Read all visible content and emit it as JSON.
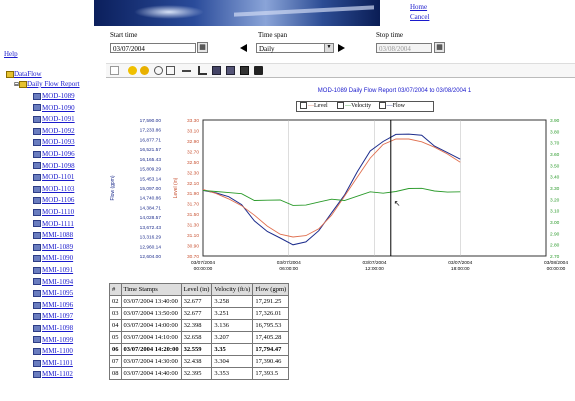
{
  "header": {
    "links": [
      "Home",
      "Cancel"
    ]
  },
  "help_link": "Help",
  "controls": {
    "start_label": "Start time",
    "start_value": "03/07/2004",
    "span_label": "Time span",
    "span_value": "Daily",
    "stop_label": "Stop time",
    "stop_value": "03/08/2004"
  },
  "sidebar": {
    "root": "DataFlow",
    "node": "Daily Flow Report",
    "items": [
      "MOD-1089",
      "MOD-1090",
      "MOD-1091",
      "MOD-1092",
      "MOD-1093",
      "MOD-1096",
      "MOD-1098",
      "MOD-1101",
      "MOD-1103",
      "MOD-1106",
      "MOD-1110",
      "MOD-1111",
      "MMI-1088",
      "MMI-1089",
      "MMI-1090",
      "MMI-1091",
      "MMI-1094",
      "MMI-1095",
      "MMI-1096",
      "MMI-1097",
      "MMI-1098",
      "MMI-1099",
      "MMI-1100",
      "MMI-1101",
      "MMI-1102"
    ]
  },
  "chart_data": {
    "type": "line",
    "title": "MOD-1089 Daily Flow Report 03/07/2004 to 03/08/2004 1",
    "ylabel": "Flow (gpm)",
    "ylabel_mid": "Level (in)",
    "ylim": [
      12600,
      17600
    ],
    "y_ticks": [
      "17,590.00",
      "17,233.86",
      "16,877.71",
      "16,521.57",
      "16,165.43",
      "15,809.29",
      "15,453.14",
      "15,097.00",
      "14,740.86",
      "14,384.71",
      "14,028.57",
      "13,672.43",
      "13,316.29",
      "12,960.14",
      "12,604.00"
    ],
    "y_mid_ticks": [
      "33.30",
      "33.10",
      "32.90",
      "32.70",
      "32.50",
      "32.30",
      "32.10",
      "31.90",
      "31.70",
      "31.50",
      "31.30",
      "31.10",
      "30.90",
      "30.70"
    ],
    "y_right_ticks": [
      "3.90",
      "3.80",
      "3.70",
      "3.60",
      "3.50",
      "3.40",
      "3.30",
      "3.20",
      "3.10",
      "3.00",
      "2.90",
      "2.80",
      "2.70"
    ],
    "x_ticks": [
      {
        "date": "03/07/2004",
        "time": "00:00:00"
      },
      {
        "date": "03/07/2004",
        "time": "06:00:00"
      },
      {
        "date": "03/07/2004",
        "time": "12:00:00"
      },
      {
        "date": "03/07/2004",
        "time": "18:00:00"
      },
      {
        "date": "03/08/2004",
        "time": "00:00:00"
      }
    ],
    "legend": [
      "Level",
      "Velocity",
      "Flow"
    ],
    "colors": {
      "level": "#e07050",
      "velocity": "#2a9a2a",
      "flow": "#1c2c8c"
    },
    "x": [
      0,
      1,
      2,
      3,
      4,
      5,
      6,
      7,
      8,
      9,
      10,
      11,
      12,
      13,
      14,
      15,
      16,
      17,
      18,
      19,
      20
    ],
    "series": [
      {
        "name": "Flow",
        "values": [
          15100,
          14950,
          14750,
          14400,
          13950,
          13500,
          13200,
          13100,
          13150,
          13500,
          14100,
          14900,
          15700,
          16400,
          16900,
          17100,
          17050,
          16950,
          16700,
          16400,
          16100
        ]
      },
      {
        "name": "Level",
        "values": [
          15050,
          14900,
          14700,
          14450,
          14100,
          13700,
          13400,
          13300,
          13350,
          13600,
          14100,
          14800,
          15500,
          16200,
          16700,
          16900,
          16900,
          16800,
          16600,
          16350,
          16050
        ]
      },
      {
        "name": "Velocity",
        "values": [
          15100,
          15000,
          14900,
          14800,
          14700,
          14650,
          14600,
          14550,
          14500,
          14550,
          14600,
          14700,
          14800,
          14900,
          15000,
          15000,
          15050,
          15000,
          15050,
          14950,
          14900
        ]
      }
    ],
    "cursor_x": 14.6
  },
  "table": {
    "headers": [
      "#",
      "Time Stamps",
      "Level (in)",
      "Velocity (ft/s)",
      "Flow (gpm)"
    ],
    "rows": [
      [
        "02",
        "03/07/2004 13:40:00",
        "32.677",
        "3.258",
        "17,291.25"
      ],
      [
        "03",
        "03/07/2004 13:50:00",
        "32.677",
        "3.251",
        "17,326.01"
      ],
      [
        "04",
        "03/07/2004 14:00:00",
        "32.398",
        "3.136",
        "16,795.53"
      ],
      [
        "05",
        "03/07/2004 14:10:00",
        "32.658",
        "3.207",
        "17,405.28"
      ],
      [
        "06",
        "03/07/2004 14:20:00",
        "32.559",
        "3.35",
        "17,794.47"
      ],
      [
        "07",
        "03/07/2004 14:30:00",
        "32.438",
        "3.304",
        "17,390.46"
      ],
      [
        "08",
        "03/07/2004 14:40:00",
        "32.395",
        "3.353",
        "17,393.5"
      ]
    ],
    "selected_row": 4
  }
}
